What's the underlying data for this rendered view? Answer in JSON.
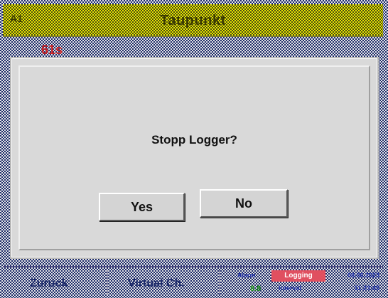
{
  "title_bar": {
    "left_label": "A1",
    "title": "Taupunkt"
  },
  "background": {
    "partial_value": "61s"
  },
  "dialog": {
    "message": "Stopp Logger?",
    "yes_label": "Yes",
    "no_label": "No"
  },
  "bottom_bar": {
    "back_label": "Zurück",
    "virtual_label": "Virtual Ch.",
    "status": {
      "alarm_label": "Alarm",
      "logging_label": "Logging",
      "indicator": "8.8",
      "interval_label": "Interval",
      "date": "08.06.2023",
      "time": "11:23:45"
    }
  },
  "colors": {
    "title_background": "#e8e800",
    "checker_dark": "#1c2a6a",
    "dialog_background": "#d9d9d9",
    "logging_badge": "#e05060"
  }
}
